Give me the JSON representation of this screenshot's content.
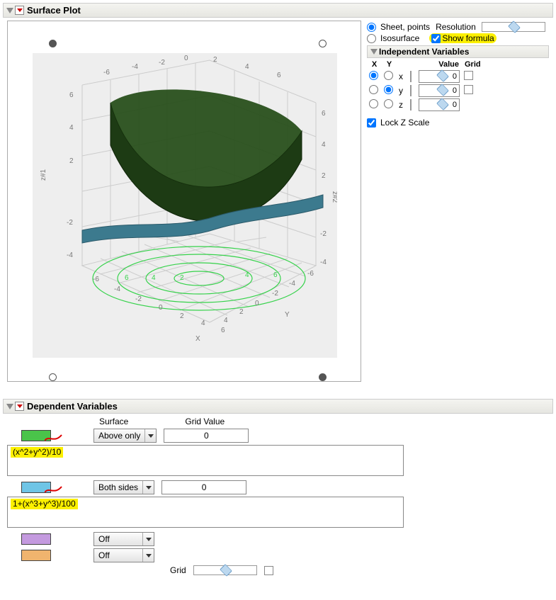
{
  "panel": {
    "title": "Surface Plot"
  },
  "controls": {
    "sheet_points_label": "Sheet, points",
    "resolution_label": "Resolution",
    "isosurface_label": "Isosurface",
    "show_formula_label": "Show formula",
    "lock_z_label": "Lock Z Scale"
  },
  "ivars": {
    "header": "Independent Variables",
    "cols": {
      "x": "X",
      "y": "Y",
      "value": "Value",
      "grid": "Grid"
    },
    "rows": [
      {
        "name": "x",
        "value": "0"
      },
      {
        "name": "y",
        "value": "0"
      },
      {
        "name": "z",
        "value": "0"
      }
    ]
  },
  "depvars": {
    "header": "Dependent Variables",
    "surface_label": "Surface",
    "gridvalue_label": "Grid Value",
    "grid_label": "Grid",
    "entries": [
      {
        "swatch": "#4ac44a",
        "surface": "Above only",
        "gridval": "0",
        "formula": "(x^2+y^2)/10",
        "show_gridval": true,
        "show_formula": true
      },
      {
        "swatch": "#6fc5e6",
        "surface": "Both sides",
        "gridval": "0",
        "formula": "1+(x^3+y^3)/100",
        "show_gridval": true,
        "show_formula": true
      },
      {
        "swatch": "#c49adf",
        "surface": "Off",
        "gridval": "",
        "formula": "",
        "show_gridval": false,
        "show_formula": false
      },
      {
        "swatch": "#f0b46e",
        "surface": "Off",
        "gridval": "",
        "formula": "",
        "show_gridval": false,
        "show_formula": false
      }
    ]
  },
  "chart_data": {
    "type": "surface3d",
    "x_range": [
      -6,
      6
    ],
    "y_range": [
      -6,
      6
    ],
    "z1_range": [
      -4,
      6
    ],
    "z2_range": [
      -4,
      6
    ],
    "x_ticks": [
      -6,
      -4,
      -2,
      0,
      2,
      4,
      6
    ],
    "y_ticks": [
      -6,
      -4,
      -2,
      0,
      2,
      4,
      6
    ],
    "z_ticks": [
      -4,
      -2,
      2,
      4,
      6
    ],
    "axis_labels": {
      "x": "X",
      "y": "Y",
      "z1": "z#1",
      "z2": "z#2"
    },
    "surfaces": [
      {
        "name": "surface-1",
        "formula": "(x^2+y^2)/10",
        "color": "#1d3b14",
        "mode": "Above only"
      },
      {
        "name": "surface-2",
        "formula": "1+(x^3+y^3)/100",
        "color": "#3c7a8e",
        "mode": "Both sides"
      }
    ],
    "contours_on_floor": true,
    "contour_color": "#35d24a"
  }
}
